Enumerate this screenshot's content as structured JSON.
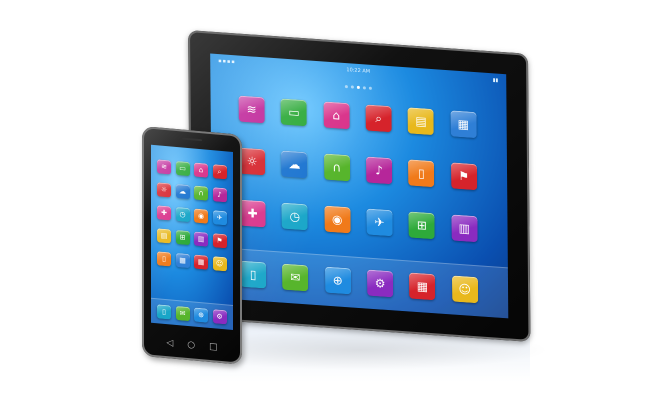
{
  "tablet": {
    "status": {
      "left": "▪▪▪▪",
      "time": "10:22 AM",
      "right": "▮▮"
    },
    "page_dots": 5,
    "active_dot": 2,
    "apps": [
      {
        "icon": "wifi-icon",
        "glyph": "≋",
        "color": "#c0279a"
      },
      {
        "icon": "chat-icon",
        "glyph": "▭",
        "color": "#2eaa3a"
      },
      {
        "icon": "home-icon",
        "glyph": "⌂",
        "color": "#d9328a"
      },
      {
        "icon": "search-icon",
        "glyph": "⌕",
        "color": "#d6232b"
      },
      {
        "icon": "folder-icon",
        "glyph": "▤",
        "color": "#e8b81c"
      },
      {
        "icon": "document-icon",
        "glyph": "▦",
        "color": "#2f7fd6"
      },
      {
        "icon": "sun-icon",
        "glyph": "☼",
        "color": "#d6232b"
      },
      {
        "icon": "cloud-icon",
        "glyph": "☁",
        "color": "#1b74d0"
      },
      {
        "icon": "headphones-icon",
        "glyph": "∩",
        "color": "#57b52c"
      },
      {
        "icon": "microphone-icon",
        "glyph": "♪",
        "color": "#b6269a"
      },
      {
        "icon": "cup-icon",
        "glyph": "▯",
        "color": "#f07a1a"
      },
      {
        "icon": "restaurant-icon",
        "glyph": "⚑",
        "color": "#d6232b"
      },
      {
        "icon": "gamepad-icon",
        "glyph": "✚",
        "color": "#d9328a"
      },
      {
        "icon": "clock-icon",
        "glyph": "◷",
        "color": "#19a6c8"
      },
      {
        "icon": "globe-icon",
        "glyph": "◉",
        "color": "#f07a1a"
      },
      {
        "icon": "airplane-icon",
        "glyph": "✈",
        "color": "#1f8be0"
      },
      {
        "icon": "cart-icon",
        "glyph": "⊞",
        "color": "#2eaa3a"
      },
      {
        "icon": "chart-icon",
        "glyph": "▥",
        "color": "#8a2bc0"
      }
    ],
    "dock": [
      {
        "icon": "phone-icon",
        "glyph": "▯",
        "color": "#19a6c8"
      },
      {
        "icon": "mail-icon",
        "glyph": "✉",
        "color": "#57b52c"
      },
      {
        "icon": "browser-icon",
        "glyph": "⊕",
        "color": "#1f8be0"
      },
      {
        "icon": "settings-icon",
        "glyph": "⚙",
        "color": "#8a2bc0"
      },
      {
        "icon": "calendar-icon",
        "glyph": "▦",
        "color": "#d6232b"
      },
      {
        "icon": "contacts-icon",
        "glyph": "☺",
        "color": "#e8b81c"
      }
    ]
  },
  "phone": {
    "apps": [
      {
        "icon": "wifi-icon",
        "glyph": "≋",
        "color": "#c0279a"
      },
      {
        "icon": "chat-icon",
        "glyph": "▭",
        "color": "#2eaa3a"
      },
      {
        "icon": "home-icon",
        "glyph": "⌂",
        "color": "#d9328a"
      },
      {
        "icon": "search-icon",
        "glyph": "⌕",
        "color": "#d6232b"
      },
      {
        "icon": "sun-icon",
        "glyph": "☼",
        "color": "#d6232b"
      },
      {
        "icon": "cloud-icon",
        "glyph": "☁",
        "color": "#1b74d0"
      },
      {
        "icon": "headphones-icon",
        "glyph": "∩",
        "color": "#57b52c"
      },
      {
        "icon": "microphone-icon",
        "glyph": "♪",
        "color": "#b6269a"
      },
      {
        "icon": "gamepad-icon",
        "glyph": "✚",
        "color": "#d9328a"
      },
      {
        "icon": "clock-icon",
        "glyph": "◷",
        "color": "#19a6c8"
      },
      {
        "icon": "globe-icon",
        "glyph": "◉",
        "color": "#f07a1a"
      },
      {
        "icon": "airplane-icon",
        "glyph": "✈",
        "color": "#1f8be0"
      },
      {
        "icon": "folder-icon",
        "glyph": "▤",
        "color": "#e8b81c"
      },
      {
        "icon": "cart-icon",
        "glyph": "⊞",
        "color": "#2eaa3a"
      },
      {
        "icon": "chart-icon",
        "glyph": "▥",
        "color": "#8a2bc0"
      },
      {
        "icon": "restaurant-icon",
        "glyph": "⚑",
        "color": "#d6232b"
      },
      {
        "icon": "cup-icon",
        "glyph": "▯",
        "color": "#f07a1a"
      },
      {
        "icon": "document-icon",
        "glyph": "▦",
        "color": "#2f7fd6"
      },
      {
        "icon": "calendar-icon",
        "glyph": "▦",
        "color": "#d6232b"
      },
      {
        "icon": "contacts-icon",
        "glyph": "☺",
        "color": "#e8b81c"
      }
    ],
    "dock": [
      {
        "icon": "phone-icon",
        "glyph": "▯",
        "color": "#19a6c8"
      },
      {
        "icon": "mail-icon",
        "glyph": "✉",
        "color": "#57b52c"
      },
      {
        "icon": "browser-icon",
        "glyph": "⊕",
        "color": "#1f8be0"
      },
      {
        "icon": "settings-icon",
        "glyph": "⚙",
        "color": "#8a2bc0"
      }
    ],
    "buttons": [
      "◁",
      "○",
      "□"
    ]
  }
}
